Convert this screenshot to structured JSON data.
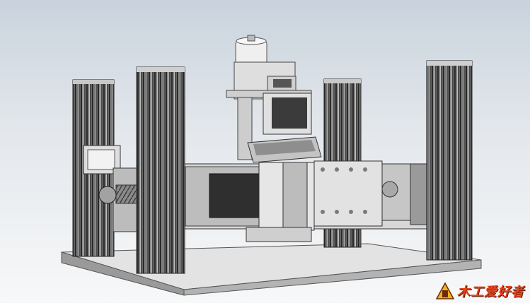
{
  "viewport": {
    "background_top": "#c9d3dd",
    "background_bottom": "#f7f8f9"
  },
  "model": {
    "description_icon": "cad-assembly-icon",
    "frame_color": "#6e6e6e",
    "body_color": "#d9d9d9",
    "motor_color": "#3a3a3a"
  },
  "watermark": {
    "logo_icon": "craft-workshop-logo",
    "text": "木工爱好者"
  }
}
